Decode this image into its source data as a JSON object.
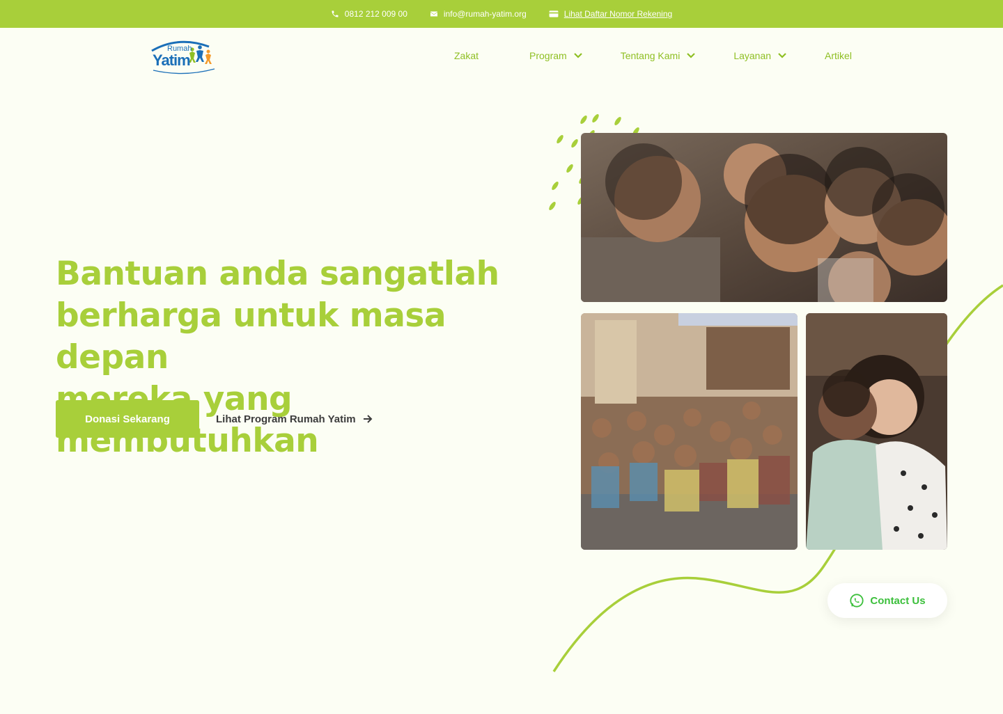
{
  "topbar": {
    "phone": "0812 212 009 00",
    "email": "info@rumah-yatim.org",
    "account_link": "Lihat Daftar Nomor Rekening"
  },
  "logo": {
    "line1": "Rumah",
    "line2": "Yatim"
  },
  "nav": {
    "items": [
      {
        "label": "Zakat",
        "dropdown": false
      },
      {
        "label": "Program",
        "dropdown": true
      },
      {
        "label": "Tentang Kami",
        "dropdown": true
      },
      {
        "label": "Layanan",
        "dropdown": true
      },
      {
        "label": "Artikel",
        "dropdown": false
      }
    ]
  },
  "hero": {
    "title_line1": "Bantuan anda sangatlah",
    "title_line2": "berharga untuk masa depan",
    "title_line3": "mereka yang membutuhkan",
    "primary_button": "Donasi Sekarang",
    "secondary_link": "Lihat Program Rumah Yatim"
  },
  "contact": {
    "label": "Contact Us"
  },
  "colors": {
    "accent": "#a8cf3a",
    "nav_text": "#8fbf23",
    "background": "#fcfef4",
    "logo_blue": "#1b6fb8",
    "whatsapp_green": "#3bbf3b"
  }
}
